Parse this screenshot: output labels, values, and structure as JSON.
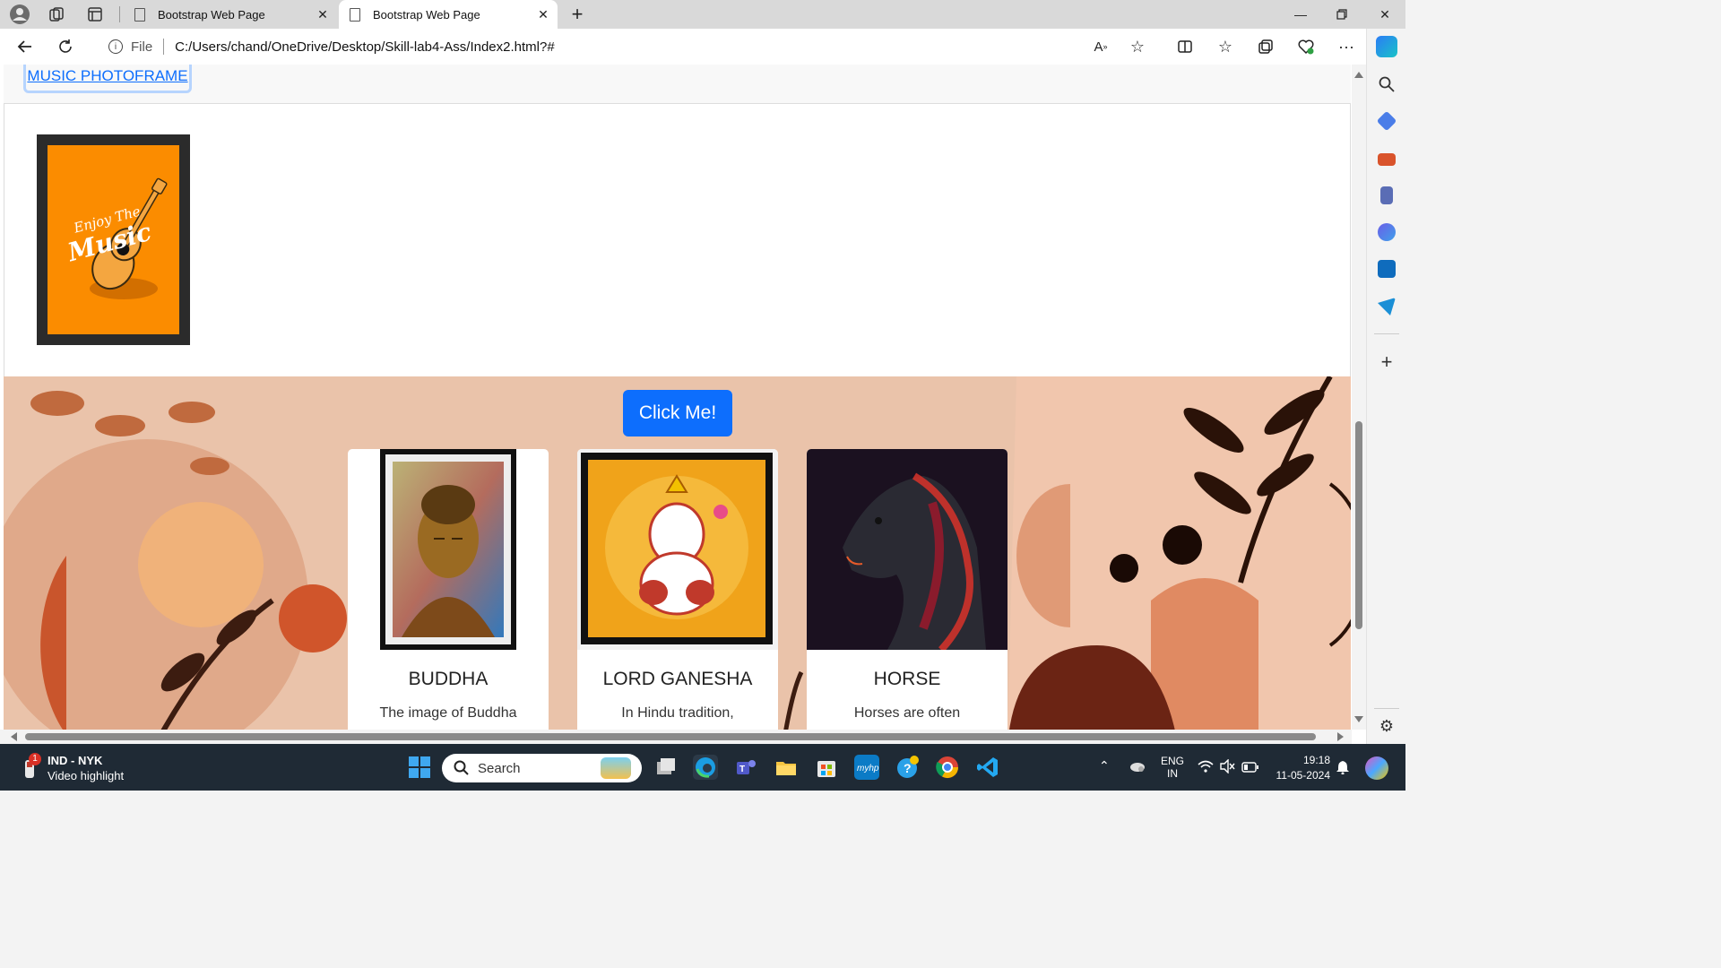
{
  "browser": {
    "tabs": [
      {
        "title": "Bootstrap Web Page"
      },
      {
        "title": "Bootstrap Web Page"
      }
    ],
    "address": {
      "scheme_label": "File",
      "url": "C:/Users/chand/OneDrive/Desktop/Skill-lab4-Ass/Index2.html?#"
    }
  },
  "page": {
    "nav_link": "MUSIC PHOTOFRAME",
    "music_frame": {
      "text_line1": "Enjoy The",
      "text_line2": "Music"
    },
    "button_label": "Click Me!",
    "cards": [
      {
        "title": "BUDDHA",
        "text": "The image of Buddha"
      },
      {
        "title": "LORD GANESHA",
        "text": "In Hindu tradition,"
      },
      {
        "title": "HORSE",
        "text": "Horses are often"
      }
    ]
  },
  "taskbar": {
    "notification_badge": "1",
    "widget_title": "IND - NYK",
    "widget_subtitle": "Video highlight",
    "search_placeholder": "Search",
    "lang": "ENG",
    "region": "IN",
    "time": "19:18",
    "date": "11-05-2024"
  },
  "colors": {
    "accent": "#0d6efd",
    "taskbar": "#1f2a35",
    "banner": "#e8bfa6"
  }
}
